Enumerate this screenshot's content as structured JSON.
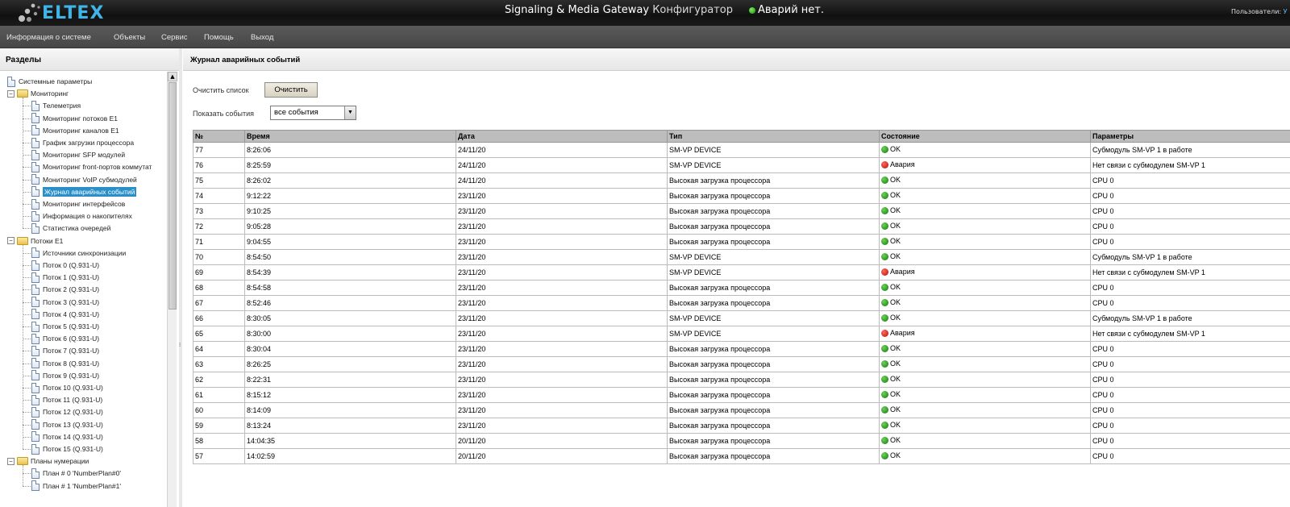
{
  "header": {
    "logo": "ELTEX",
    "title_main": "Signaling & Media Gateway",
    "title_sub": "Конфигуратор",
    "alarm_status": "Аварий нет.",
    "users_label": "Пользователи:",
    "users_value": "У"
  },
  "menu": [
    "Информация о системе",
    "Объекты",
    "Сервис",
    "Помощь",
    "Выход"
  ],
  "sidebar": {
    "title": "Разделы",
    "tree": [
      {
        "label": "Системные параметры",
        "level": 0,
        "type": "doc"
      },
      {
        "label": "Мониторинг",
        "level": 0,
        "type": "folder",
        "expanded": true
      },
      {
        "label": "Телеметрия",
        "level": 1,
        "type": "doc"
      },
      {
        "label": "Мониторинг потоков E1",
        "level": 1,
        "type": "doc"
      },
      {
        "label": "Мониторинг каналов E1",
        "level": 1,
        "type": "doc"
      },
      {
        "label": "График загрузки процессора",
        "level": 1,
        "type": "doc"
      },
      {
        "label": "Мониторинг SFP модулей",
        "level": 1,
        "type": "doc"
      },
      {
        "label": "Мониторинг front-портов коммутат",
        "level": 1,
        "type": "doc"
      },
      {
        "label": "Мониторинг VoIP субмодулей",
        "level": 1,
        "type": "doc"
      },
      {
        "label": "Журнал аварийных событий",
        "level": 1,
        "type": "doc",
        "selected": true
      },
      {
        "label": "Мониторинг интерфейсов",
        "level": 1,
        "type": "doc"
      },
      {
        "label": "Информация о накопителях",
        "level": 1,
        "type": "doc"
      },
      {
        "label": "Статистика очередей",
        "level": 1,
        "type": "doc"
      },
      {
        "label": "Потоки E1",
        "level": 0,
        "type": "folder",
        "expanded": true
      },
      {
        "label": "Источники синхронизации",
        "level": 1,
        "type": "doc"
      },
      {
        "label": "Поток 0 (Q.931-U)",
        "level": 1,
        "type": "doc"
      },
      {
        "label": "Поток 1 (Q.931-U)",
        "level": 1,
        "type": "doc"
      },
      {
        "label": "Поток 2 (Q.931-U)",
        "level": 1,
        "type": "doc"
      },
      {
        "label": "Поток 3 (Q.931-U)",
        "level": 1,
        "type": "doc"
      },
      {
        "label": "Поток 4 (Q.931-U)",
        "level": 1,
        "type": "doc"
      },
      {
        "label": "Поток 5 (Q.931-U)",
        "level": 1,
        "type": "doc"
      },
      {
        "label": "Поток 6 (Q.931-U)",
        "level": 1,
        "type": "doc"
      },
      {
        "label": "Поток 7 (Q.931-U)",
        "level": 1,
        "type": "doc"
      },
      {
        "label": "Поток 8 (Q.931-U)",
        "level": 1,
        "type": "doc"
      },
      {
        "label": "Поток 9 (Q.931-U)",
        "level": 1,
        "type": "doc"
      },
      {
        "label": "Поток 10 (Q.931-U)",
        "level": 1,
        "type": "doc"
      },
      {
        "label": "Поток 11 (Q.931-U)",
        "level": 1,
        "type": "doc"
      },
      {
        "label": "Поток 12 (Q.931-U)",
        "level": 1,
        "type": "doc"
      },
      {
        "label": "Поток 13 (Q.931-U)",
        "level": 1,
        "type": "doc"
      },
      {
        "label": "Поток 14 (Q.931-U)",
        "level": 1,
        "type": "doc"
      },
      {
        "label": "Поток 15 (Q.931-U)",
        "level": 1,
        "type": "doc"
      },
      {
        "label": "Планы нумерации",
        "level": 0,
        "type": "folder",
        "expanded": true
      },
      {
        "label": "План # 0 'NumberPlan#0'",
        "level": 1,
        "type": "doc"
      },
      {
        "label": "План # 1 'NumberPlan#1'",
        "level": 1,
        "type": "doc"
      }
    ]
  },
  "main": {
    "title": "Журнал аварийных событий",
    "clear_label": "Очистить список",
    "clear_button": "Очистить",
    "show_label": "Показать события",
    "show_value": "все события",
    "columns": [
      "№",
      "Время",
      "Дата",
      "Тип",
      "Состояние",
      "Параметры"
    ],
    "rows": [
      [
        "77",
        "8:26:06",
        "24/11/20",
        "SM-VP DEVICE",
        "OK",
        "Субмодуль SM-VP 1 в работе"
      ],
      [
        "76",
        "8:25:59",
        "24/11/20",
        "SM-VP DEVICE",
        "Авария",
        "Нет связи с субмодулем SM-VP 1"
      ],
      [
        "75",
        "8:26:02",
        "24/11/20",
        "Высокая загрузка процессора",
        "OK",
        "CPU 0"
      ],
      [
        "74",
        "9:12:22",
        "23/11/20",
        "Высокая загрузка процессора",
        "OK",
        "CPU 0"
      ],
      [
        "73",
        "9:10:25",
        "23/11/20",
        "Высокая загрузка процессора",
        "OK",
        "CPU 0"
      ],
      [
        "72",
        "9:05:28",
        "23/11/20",
        "Высокая загрузка процессора",
        "OK",
        "CPU 0"
      ],
      [
        "71",
        "9:04:55",
        "23/11/20",
        "Высокая загрузка процессора",
        "OK",
        "CPU 0"
      ],
      [
        "70",
        "8:54:50",
        "23/11/20",
        "SM-VP DEVICE",
        "OK",
        "Субмодуль SM-VP 1 в работе"
      ],
      [
        "69",
        "8:54:39",
        "23/11/20",
        "SM-VP DEVICE",
        "Авария",
        "Нет связи с субмодулем SM-VP 1"
      ],
      [
        "68",
        "8:54:58",
        "23/11/20",
        "Высокая загрузка процессора",
        "OK",
        "CPU 0"
      ],
      [
        "67",
        "8:52:46",
        "23/11/20",
        "Высокая загрузка процессора",
        "OK",
        "CPU 0"
      ],
      [
        "66",
        "8:30:05",
        "23/11/20",
        "SM-VP DEVICE",
        "OK",
        "Субмодуль SM-VP 1 в работе"
      ],
      [
        "65",
        "8:30:00",
        "23/11/20",
        "SM-VP DEVICE",
        "Авария",
        "Нет связи с субмодулем SM-VP 1"
      ],
      [
        "64",
        "8:30:04",
        "23/11/20",
        "Высокая загрузка процессора",
        "OK",
        "CPU 0"
      ],
      [
        "63",
        "8:26:25",
        "23/11/20",
        "Высокая загрузка процессора",
        "OK",
        "CPU 0"
      ],
      [
        "62",
        "8:22:31",
        "23/11/20",
        "Высокая загрузка процессора",
        "OK",
        "CPU 0"
      ],
      [
        "61",
        "8:15:12",
        "23/11/20",
        "Высокая загрузка процессора",
        "OK",
        "CPU 0"
      ],
      [
        "60",
        "8:14:09",
        "23/11/20",
        "Высокая загрузка процессора",
        "OK",
        "CPU 0"
      ],
      [
        "59",
        "8:13:24",
        "23/11/20",
        "Высокая загрузка процессора",
        "OK",
        "CPU 0"
      ],
      [
        "58",
        "14:04:35",
        "20/11/20",
        "Высокая загрузка процессора",
        "OK",
        "CPU 0"
      ],
      [
        "57",
        "14:02:59",
        "20/11/20",
        "Высокая загрузка процессора",
        "OK",
        "CPU 0"
      ]
    ]
  },
  "colors": {
    "ok": "#1b8e12",
    "alarm": "#c0150e",
    "selected": "#2a8fc9",
    "logo": "#3fb4e6"
  }
}
